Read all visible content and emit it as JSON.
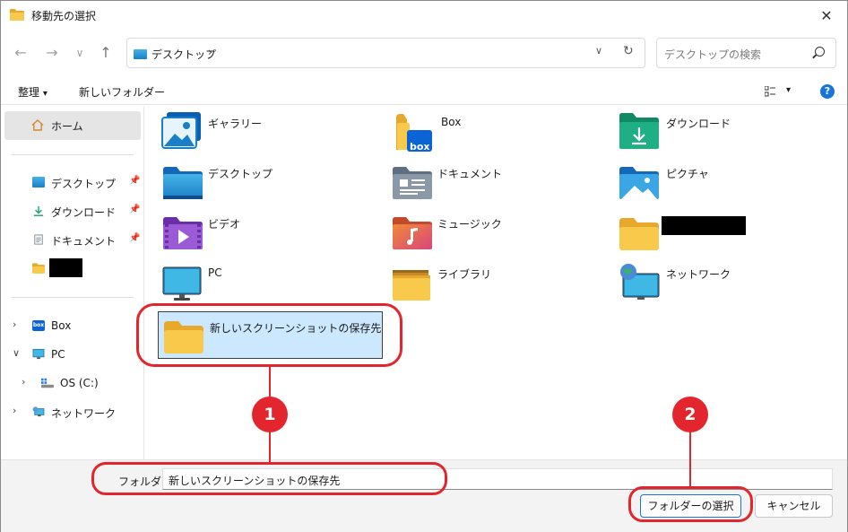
{
  "window": {
    "title": "移動先の選択",
    "close_glyph": "✕"
  },
  "nav": {
    "back": "←",
    "forward": "→",
    "recent": "∨",
    "up": "↑"
  },
  "address": {
    "path": "デスクトップ",
    "separator": "›",
    "dropdown": "∨",
    "refresh": "↻"
  },
  "search": {
    "placeholder": "デスクトップの検索"
  },
  "toolbar": {
    "organize": "整理",
    "organize_arrow": "▾",
    "new_folder": "新しいフォルダー",
    "view_arrow": "▾",
    "help": "?"
  },
  "sidebar": {
    "home": "ホーム",
    "pinned": [
      {
        "label": "デスクトップ",
        "icon": "desktop-icon"
      },
      {
        "label": "ダウンロード",
        "icon": "download-icon"
      },
      {
        "label": "ドキュメント",
        "icon": "documents-icon"
      }
    ],
    "tree": [
      {
        "label": "Box",
        "expander": "›",
        "icon": "box-icon"
      },
      {
        "label": "PC",
        "expander": "∨",
        "icon": "pc-icon"
      },
      {
        "label": "OS (C:)",
        "expander": "›",
        "icon": "drive-icon"
      },
      {
        "label": "ネットワーク",
        "expander": "›",
        "icon": "network-icon"
      }
    ]
  },
  "items": [
    {
      "label": "ギャラリー",
      "icon": "gallery-icon"
    },
    {
      "label": "Box",
      "icon": "box-folder-icon"
    },
    {
      "label": "ダウンロード",
      "icon": "download-folder-icon"
    },
    {
      "label": "デスクトップ",
      "icon": "desktop-folder-icon"
    },
    {
      "label": "ドキュメント",
      "icon": "documents-folder-icon"
    },
    {
      "label": "ピクチャ",
      "icon": "pictures-folder-icon"
    },
    {
      "label": "ビデオ",
      "icon": "videos-folder-icon"
    },
    {
      "label": "ミュージック",
      "icon": "music-folder-icon"
    },
    {
      "label": "",
      "icon": "folder-icon"
    },
    {
      "label": "PC",
      "icon": "pc-icon"
    },
    {
      "label": "ライブラリ",
      "icon": "library-folder-icon"
    },
    {
      "label": "ネットワーク",
      "icon": "network-icon"
    },
    {
      "label": "新しいスクリーンショットの保存先",
      "icon": "folder-icon",
      "selected": true
    }
  ],
  "bottom": {
    "folder_label": "フォルダー:",
    "folder_value": "新しいスクリーンショットの保存先",
    "select_button": "フォルダーの選択",
    "cancel_button": "キャンセル"
  },
  "callouts": [
    {
      "number": "1"
    },
    {
      "number": "2"
    }
  ],
  "colors": {
    "accent": "#1a73d9",
    "callout": "#e3252d",
    "selection": "#cce8ff",
    "folder": "#f8c94b"
  }
}
